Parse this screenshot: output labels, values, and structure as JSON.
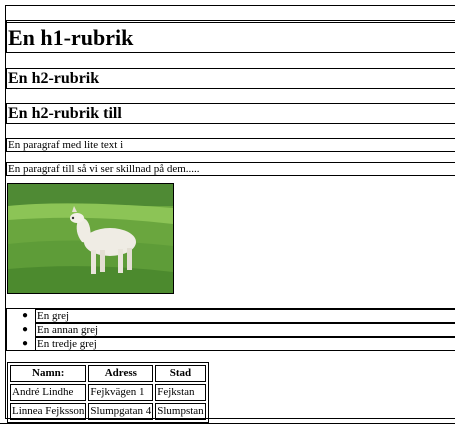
{
  "headings": {
    "h1": "En h1-rubrik",
    "h2_first": "En h2-rubrik",
    "h2_second": "En h2-rubrik till"
  },
  "paragraphs": [
    "En paragraf med lite text i",
    "En paragraf till så vi ser skillnad på dem....."
  ],
  "image": {
    "subject": "alpaca-on-grass-photo",
    "colors": {
      "grass": "#6aa63e",
      "grass_dark": "#3f7d2a",
      "field": "#8cc456",
      "alpaca": "#efece4"
    }
  },
  "list_items": [
    "En grej",
    "En annan grej",
    "En tredje grej"
  ],
  "table": {
    "headers": [
      "Namn:",
      "Adress",
      "Stad"
    ],
    "rows": [
      [
        "André Lindhe",
        "Fejkvägen 1",
        "Fejkstan"
      ],
      [
        "Linnea Fejksson",
        "Slumpgatan 4",
        "Slumpstan"
      ]
    ]
  }
}
